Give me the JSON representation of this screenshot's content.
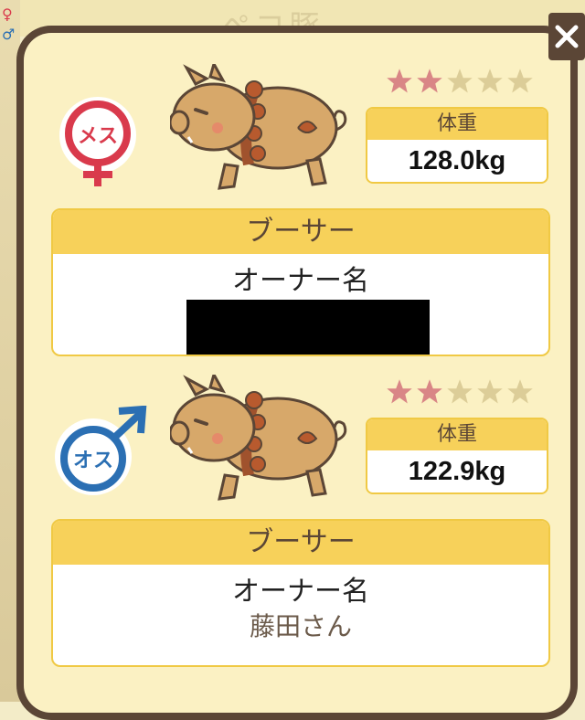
{
  "background": {
    "title_fragment": "ペコ豚"
  },
  "close_label": "×",
  "pigs": [
    {
      "sex_label": "メス",
      "rating": 2,
      "max_rating": 5,
      "weight_label": "体重",
      "weight_value": "128.0kg",
      "breeder_title": "ブーサー",
      "owner_label": "オーナー名",
      "owner_name": ""
    },
    {
      "sex_label": "オス",
      "rating": 2,
      "max_rating": 5,
      "weight_label": "体重",
      "weight_value": "122.9kg",
      "breeder_title": "ブーサー",
      "owner_label": "オーナー名",
      "owner_name": "藤田さん"
    }
  ],
  "colors": {
    "female": "#d93a4c",
    "male": "#2b6fb3",
    "star_on": "#d98686",
    "star_off": "#dccd98",
    "accent": "#f7d15a",
    "frame": "#5b4636"
  }
}
